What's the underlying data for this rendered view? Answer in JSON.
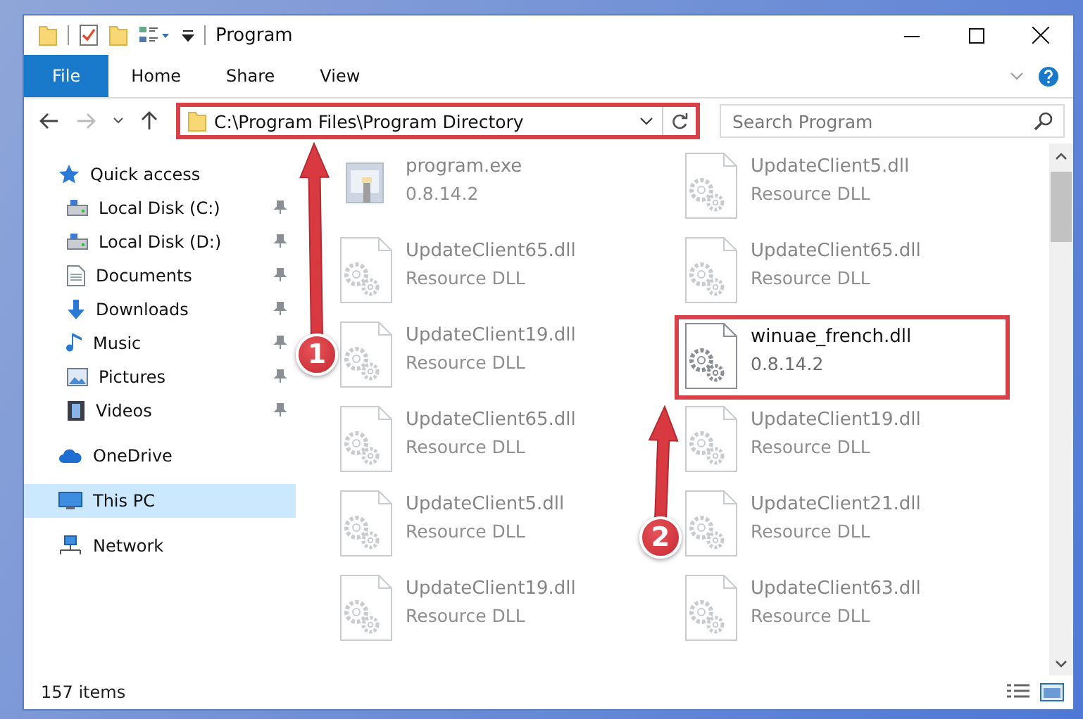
{
  "window": {
    "title": "Program"
  },
  "ribbon_tabs": [
    {
      "label": "File",
      "selected": true
    },
    {
      "label": "Home",
      "selected": false
    },
    {
      "label": "Share",
      "selected": false
    },
    {
      "label": "View",
      "selected": false
    }
  ],
  "address_bar": {
    "path": "C:\\Program Files\\Program Directory",
    "highlighted": true
  },
  "search": {
    "placeholder": "Search Program"
  },
  "sidebar": {
    "items": [
      {
        "label": "Quick access",
        "kind": "star",
        "selected": false,
        "children": [
          {
            "label": "Local Disk (C:)",
            "kind": "drive",
            "pinned": true,
            "selected": false
          },
          {
            "label": "Local Disk (D:)",
            "kind": "drive",
            "pinned": true,
            "selected": false
          },
          {
            "label": "Documents",
            "kind": "document",
            "pinned": true,
            "selected": false
          },
          {
            "label": "Downloads",
            "kind": "download",
            "pinned": true,
            "selected": false
          },
          {
            "label": "Music",
            "kind": "music",
            "pinned": true,
            "selected": false
          },
          {
            "label": "Pictures",
            "kind": "pictures",
            "pinned": true,
            "selected": false
          },
          {
            "label": "Videos",
            "kind": "video",
            "pinned": true,
            "selected": false
          }
        ]
      },
      {
        "label": "OneDrive",
        "kind": "cloud",
        "selected": false
      },
      {
        "label": "This PC",
        "kind": "pc",
        "selected": true
      },
      {
        "label": "Network",
        "kind": "network",
        "selected": false
      }
    ]
  },
  "files": [
    {
      "name": "program.exe",
      "detail": "0.8.14.2",
      "kind": "exe",
      "faded": true,
      "highlighted": false
    },
    {
      "name": "UpdateClient5.dll",
      "detail": "Resource DLL",
      "kind": "dll",
      "faded": true,
      "highlighted": false
    },
    {
      "name": "UpdateClient65.dll",
      "detail": "Resource DLL",
      "kind": "dll",
      "faded": true,
      "highlighted": false
    },
    {
      "name": "UpdateClient65.dll",
      "detail": "Resource DLL",
      "kind": "dll",
      "faded": true,
      "highlighted": false
    },
    {
      "name": "UpdateClient19.dll",
      "detail": "Resource DLL",
      "kind": "dll",
      "faded": true,
      "highlighted": false
    },
    {
      "name": "winuae_french.dll",
      "detail": "0.8.14.2",
      "kind": "dll",
      "faded": false,
      "highlighted": true
    },
    {
      "name": "UpdateClient65.dll",
      "detail": "Resource DLL",
      "kind": "dll",
      "faded": true,
      "highlighted": false
    },
    {
      "name": "UpdateClient19.dll",
      "detail": "Resource DLL",
      "kind": "dll",
      "faded": true,
      "highlighted": false
    },
    {
      "name": "UpdateClient5.dll",
      "detail": "Resource DLL",
      "kind": "dll",
      "faded": true,
      "highlighted": false
    },
    {
      "name": "UpdateClient21.dll",
      "detail": "Resource DLL",
      "kind": "dll",
      "faded": true,
      "highlighted": false
    },
    {
      "name": "UpdateClient19.dll",
      "detail": "Resource DLL",
      "kind": "dll",
      "faded": true,
      "highlighted": false
    },
    {
      "name": "UpdateClient63.dll",
      "detail": "Resource DLL",
      "kind": "dll",
      "faded": true,
      "highlighted": false
    }
  ],
  "annotations": [
    {
      "label": "1"
    },
    {
      "label": "2"
    }
  ],
  "status_bar": {
    "count": "157 items"
  }
}
